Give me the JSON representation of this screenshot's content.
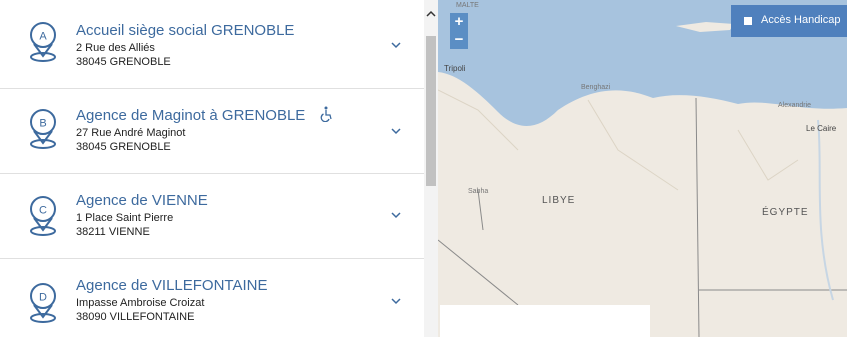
{
  "agencies": [
    {
      "letter": "A",
      "title": "Accueil siège social GRENOBLE",
      "street": "2 Rue des Alliés",
      "city": "38045 GRENOBLE",
      "accessible": false
    },
    {
      "letter": "B",
      "title": "Agence de Maginot à GRENOBLE",
      "street": "27 Rue André Maginot",
      "city": "38045 GRENOBLE",
      "accessible": true
    },
    {
      "letter": "C",
      "title": "Agence de VIENNE",
      "street": "1 Place Saint Pierre",
      "city": "38211 VIENNE",
      "accessible": false
    },
    {
      "letter": "D",
      "title": "Agence de VILLEFONTAINE",
      "street": "Impasse Ambroise Croizat",
      "city": "38090 VILLEFONTAINE",
      "accessible": false
    }
  ],
  "map": {
    "zoom_in": "+",
    "zoom_out": "−",
    "access_filter_label": "Accès Handicap",
    "labels": {
      "malta": "MALTE",
      "tripoli": "Tripoli",
      "benghazi": "Benghazi",
      "alexandria": "Alexandrie",
      "cairo": "Le Caire",
      "sabha": "Sabha",
      "libya": "LIBYE",
      "egypt": "ÉGYPTE"
    }
  },
  "colors": {
    "accent": "#3d6a9e",
    "button": "#4f80bd",
    "sea": "#a7c3de",
    "land": "#efeae2"
  }
}
